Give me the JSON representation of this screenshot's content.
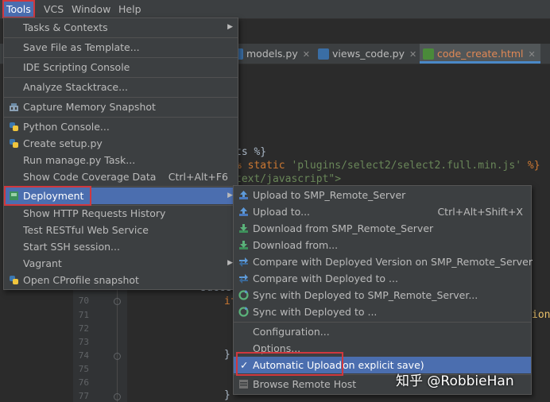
{
  "menubar": {
    "items": [
      "Tools",
      "VCS",
      "Window",
      "Help"
    ]
  },
  "tabs": [
    {
      "label": "models.py"
    },
    {
      "label": "views_code.py"
    },
    {
      "label": "code_create.html"
    }
  ],
  "editor": {
    "code_line_1": "ts %}",
    "code_line_2_kw": "% static",
    "code_line_2_str": "'plugins/select2/select2.full.min.js'",
    "code_line_2_end": "%}",
    "code_line_3": "text/javascript\">",
    "succe": "succe",
    "if_kw": "if",
    "brace": "}",
    "brace2": "}",
    "ion": "ion",
    "line_numbers": [
      "70",
      "71",
      "72",
      "73",
      "74",
      "75",
      "76",
      "77"
    ]
  },
  "tools_menu": {
    "items": [
      {
        "label": "Tasks & Contexts"
      },
      {
        "label": "Save File as Template..."
      },
      {
        "label": "IDE Scripting Console"
      },
      {
        "label": "Analyze Stacktrace..."
      },
      {
        "label": "Capture Memory Snapshot"
      },
      {
        "label": "Python Console..."
      },
      {
        "label": "Create setup.py"
      },
      {
        "label": "Run manage.py Task..."
      },
      {
        "label": "Show Code Coverage Data",
        "shortcut": "Ctrl+Alt+F6"
      },
      {
        "label": "Deployment"
      },
      {
        "label": "Show HTTP Requests History"
      },
      {
        "label": "Test RESTful Web Service"
      },
      {
        "label": "Start SSH session..."
      },
      {
        "label": "Vagrant"
      },
      {
        "label": "Open CProfile snapshot"
      }
    ]
  },
  "deployment_menu": {
    "items": [
      {
        "label": "Upload to SMP_Remote_Server"
      },
      {
        "label": "Upload to...",
        "shortcut": "Ctrl+Alt+Shift+X"
      },
      {
        "label": "Download from SMP_Remote_Server"
      },
      {
        "label": "Download from..."
      },
      {
        "label": "Compare with Deployed Version on SMP_Remote_Server"
      },
      {
        "label": "Compare with Deployed to ..."
      },
      {
        "label": "Sync with Deployed to SMP_Remote_Server..."
      },
      {
        "label": "Sync with Deployed to ..."
      },
      {
        "label": "Configuration..."
      },
      {
        "label": "Options..."
      },
      {
        "label": "Automatic Upload",
        "suffix": "on explicit save)",
        "checked": true
      },
      {
        "label": "Browse Remote Host"
      }
    ]
  },
  "watermark": "知乎 @RobbieHan",
  "colors": {
    "accent": "#4b6eaf",
    "highlight_box": "#d0383e"
  }
}
